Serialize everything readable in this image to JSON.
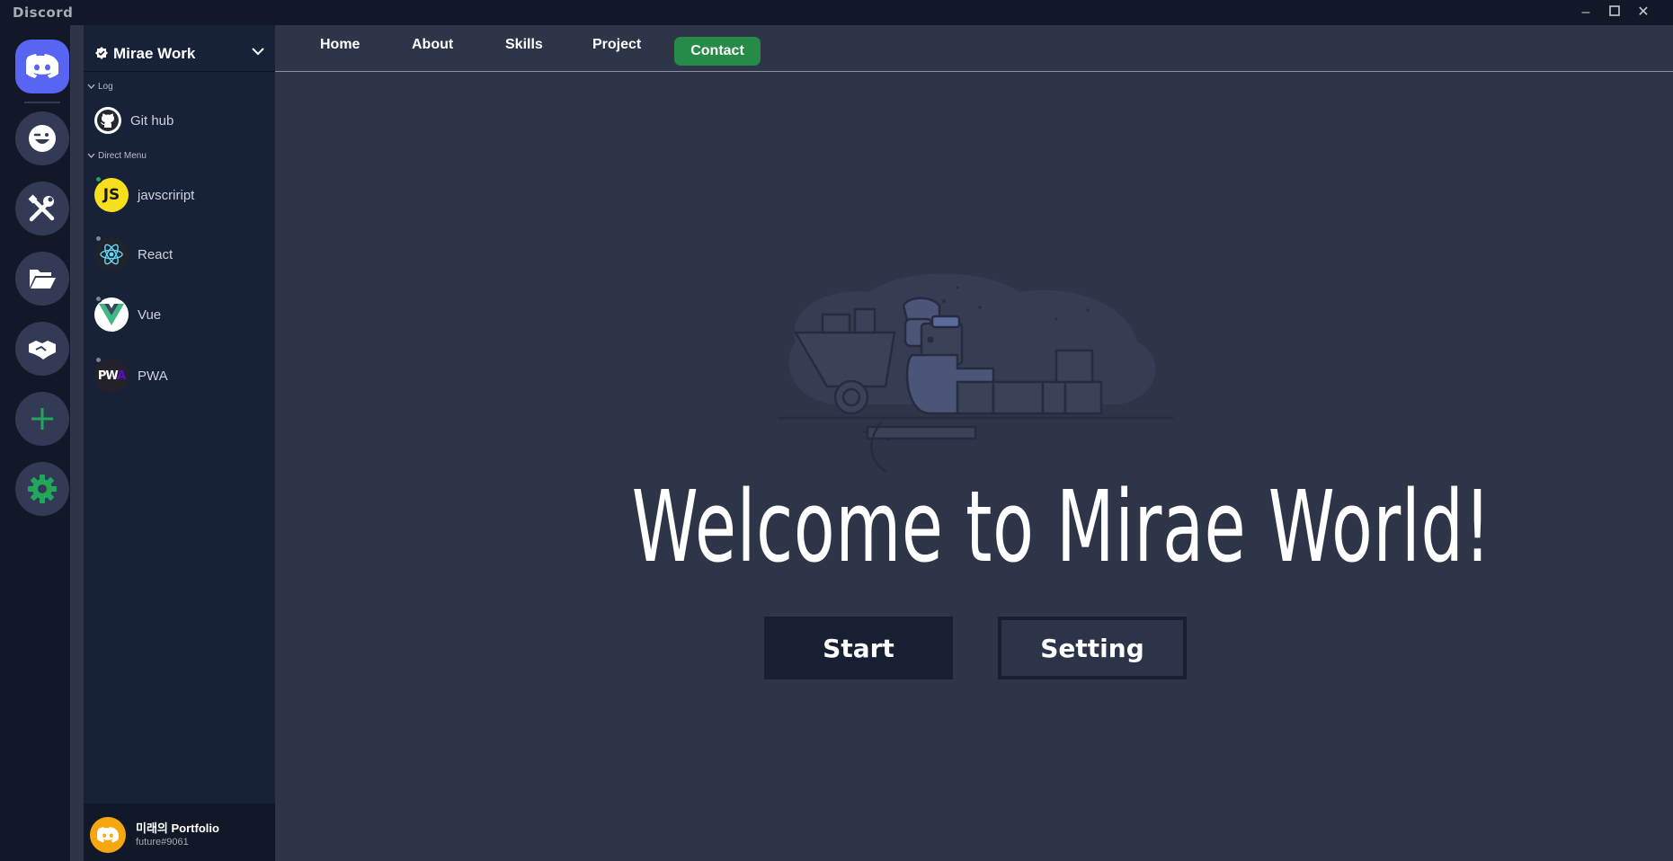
{
  "window": {
    "title": "Discord",
    "controls": [
      "minimize",
      "maximize",
      "close"
    ]
  },
  "server_rail": {
    "items": [
      {
        "name": "discord-home",
        "icon": "discord-logo-icon"
      },
      {
        "name": "emoji",
        "icon": "winking-face-icon"
      },
      {
        "name": "skills",
        "icon": "tools-icon"
      },
      {
        "name": "projects",
        "icon": "folder-open-icon"
      },
      {
        "name": "contact",
        "icon": "handshake-icon"
      },
      {
        "name": "add-server",
        "icon": "plus-icon"
      },
      {
        "name": "settings",
        "icon": "gear-icon"
      }
    ],
    "accent_green": "#23a55a",
    "brand_color": "#5865f2"
  },
  "channel_sidebar": {
    "server_name": "Mirae Work",
    "categories": [
      {
        "label": "Log"
      },
      {
        "label": "Direct Menu"
      }
    ],
    "log_items": [
      {
        "label": "Git hub",
        "icon": "github-icon"
      }
    ],
    "dm_items": [
      {
        "label": "javscriript",
        "icon": "javascript-logo-icon",
        "status": "online"
      },
      {
        "label": "React",
        "icon": "react-logo-icon",
        "status": "offline"
      },
      {
        "label": "Vue",
        "icon": "vue-logo-icon",
        "status": "offline"
      },
      {
        "label": "PWA",
        "icon": "pwa-logo-icon",
        "status": "offline"
      }
    ],
    "user": {
      "name": "미래의 Portfolio",
      "tag": "future#9061",
      "avatar_color": "#f6a60f"
    }
  },
  "topnav": {
    "items": [
      "Home",
      "About",
      "Skills",
      "Project"
    ],
    "contact_label": "Contact",
    "contact_color": "#258b47"
  },
  "main": {
    "headline": "Welcome to Mirae World!",
    "start_label": "Start",
    "setting_label": "Setting"
  }
}
